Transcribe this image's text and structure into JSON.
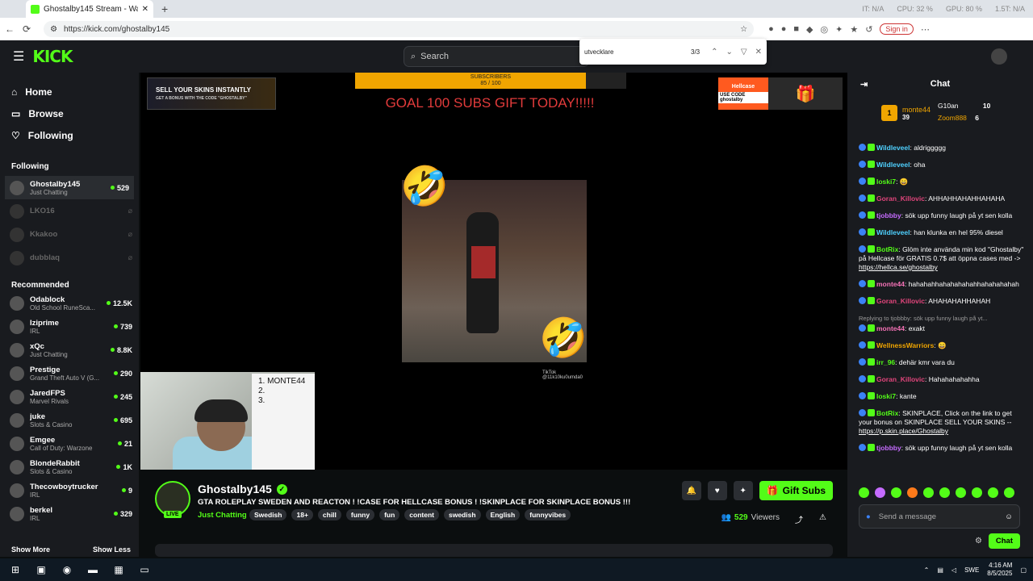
{
  "browser": {
    "tab_title": "Ghostalby145 Stream - Watc",
    "url": "https://kick.com/ghostalby145",
    "signin": "Sign in",
    "sysmon": [
      "IT: N/A",
      "CPU: 32 %",
      "GPU: 80 %",
      "1.5T: N/A"
    ]
  },
  "find": {
    "query": "utvecklare",
    "count": "3/3"
  },
  "kick": {
    "logo": "KICK",
    "search_placeholder": "Search"
  },
  "nav": {
    "home": "Home",
    "browse": "Browse",
    "following": "Following"
  },
  "sidebar": {
    "following_title": "Following",
    "following": [
      {
        "name": "Ghostalby145",
        "cat": "Just Chatting",
        "viewers": "529"
      },
      {
        "name": "LKO16"
      },
      {
        "name": "Kkakoo"
      },
      {
        "name": "dubblaq"
      }
    ],
    "recommended_title": "Recommended",
    "recommended": [
      {
        "name": "Odablock",
        "cat": "Old School RuneSca...",
        "viewers": "12.5K"
      },
      {
        "name": "Iziprime",
        "cat": "IRL",
        "viewers": "739"
      },
      {
        "name": "xQc",
        "cat": "Just Chatting",
        "viewers": "8.8K"
      },
      {
        "name": "Prestige",
        "cat": "Grand Theft Auto V (G...",
        "viewers": "290"
      },
      {
        "name": "JaredFPS",
        "cat": "Marvel Rivals",
        "viewers": "245"
      },
      {
        "name": "juke",
        "cat": "Slots & Casino",
        "viewers": "695"
      },
      {
        "name": "Emgee",
        "cat": "Call of Duty: Warzone",
        "viewers": "21"
      },
      {
        "name": "BlondeRabbit",
        "cat": "Slots & Casino",
        "viewers": "1K"
      },
      {
        "name": "Thecowboytrucker",
        "cat": "IRL",
        "viewers": "9"
      },
      {
        "name": "berkel",
        "cat": "IRL",
        "viewers": "329"
      }
    ],
    "show_more": "Show More",
    "show_less": "Show Less"
  },
  "player": {
    "ad_left": "SELL YOUR SKINS INSTANTLY",
    "ad_left_sub": "GET A BONUS WITH THE CODE \"GHOSTALBY\"",
    "sub_goal_label": "SUBSCRIBERS",
    "sub_goal_count": "85 / 100",
    "sub_goal_progress": 0.85,
    "goal_text": "GOAL 100 SUBS GIFT TODAY!!!!!",
    "ad_right_brand": "Hellcase",
    "ad_right_code_label": "USE CODE",
    "ad_right_code": "ghostalby",
    "tiktok": "TikTok",
    "tiktok_user": "@11k10ku0umda0",
    "board": [
      "1.  MONTE44",
      "2.",
      "3."
    ]
  },
  "channel": {
    "name": "Ghostalby145",
    "live": "LIVE",
    "title": "GTA ROLEPLAY SWEDEN  AND REACTON ! !CASE FOR HELLCASE BONUS ! !SKINPLACE FOR SKINPLACE BONUS !!!",
    "category": "Just Chatting",
    "tags": [
      "Swedish",
      "18+",
      "chill",
      "funny",
      "fun",
      "content",
      "swedish",
      "English",
      "funnyvibes"
    ],
    "gift": "Gift Subs",
    "viewers_count": "529",
    "viewers_label": "Viewers"
  },
  "chat": {
    "title": "Chat",
    "leader_first_name": "monte44",
    "leader_first_count": "39",
    "leader_others": [
      {
        "name": "G10an",
        "count": "10"
      },
      {
        "name": "Zoom888",
        "count": "6"
      }
    ],
    "messages": [
      {
        "user": "Wildleveel",
        "color": "#4fd1ff",
        "text": "aldriggggg"
      },
      {
        "user": "Wildleveel",
        "color": "#4fd1ff",
        "text": "oha"
      },
      {
        "user": "loski7",
        "color": "#53fc18",
        "text": "😄"
      },
      {
        "user": "Goran_Killovic",
        "color": "#e0457b",
        "text": "AHHAHHAHAHHAHAHA"
      },
      {
        "user": "tjobbby",
        "color": "#c56bff",
        "text": "sök upp funny laugh på yt sen kolla"
      },
      {
        "user": "Wildleveel",
        "color": "#4fd1ff",
        "text": "han klunka en hel 95% diesel"
      },
      {
        "user": "BotRix",
        "color": "#53fc18",
        "text": "Glöm inte använda min kod \"Ghostalby\" på Hellcase för GRATIS 0.7$ att öppna cases med ->",
        "link": "https://hellca.se/ghostalby"
      },
      {
        "user": "monte44",
        "color": "#f472b6",
        "text": "hahahahhahahahahahhahahahahah"
      },
      {
        "user": "Goran_Killovic",
        "color": "#e0457b",
        "text": "AHAHAHAHHAHAH"
      },
      {
        "user": "monte44",
        "color": "#f472b6",
        "text": "exakt",
        "reply": "Replying to tjobbby: sök upp funny laugh på yt..."
      },
      {
        "user": "WellnessWarriors",
        "color": "#f0a500",
        "text": "😄"
      },
      {
        "user": "irr_96",
        "color": "#53fc18",
        "text": "dehär kmr vara du"
      },
      {
        "user": "Goran_Killovic",
        "color": "#e0457b",
        "text": "Hahahahahahha"
      },
      {
        "user": "loski7",
        "color": "#53fc18",
        "text": "kante"
      },
      {
        "user": "BotRix",
        "color": "#53fc18",
        "text": "SKINPLACE, Click on the link to get your bonus on SKINPLACE SELL YOUR SKINS --",
        "link": "https://p.skin.place/Ghostalby"
      },
      {
        "user": "tjobbby",
        "color": "#c56bff",
        "text": "sök upp funny laugh på yt sen kolla"
      }
    ],
    "input_placeholder": "Send a message",
    "send": "Chat"
  },
  "taskbar": {
    "lang": "SWE",
    "time": "4:16 AM",
    "date": "8/5/2025"
  }
}
